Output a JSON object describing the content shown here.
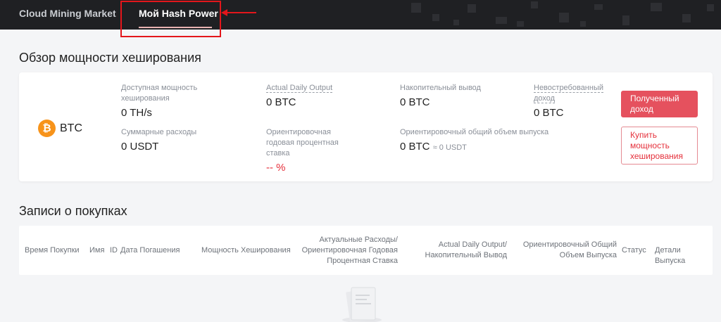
{
  "nav": {
    "market": "Cloud Mining Market",
    "hash_power": "Мой Hash Power"
  },
  "overview": {
    "title": "Обзор мощности хеширования",
    "coin": "BTC",
    "stats": {
      "available_label": "Доступная мощность хеширования",
      "available_value": "0 TH/s",
      "total_expense_label": "Суммарные расходы",
      "total_expense_value": "0 USDT",
      "daily_output_label": "Actual Daily Output",
      "daily_output_value": "0 BTC",
      "annual_rate_label": "Ориентировочная годовая процентная ставка",
      "annual_rate_value": "-- %",
      "accumulated_label": "Накопительный вывод",
      "accumulated_value": "0 BTC",
      "total_output_label": "Ориентировочный общий объем выпуска",
      "total_output_value": "0 BTC",
      "total_output_approx": "≈ 0 USDT",
      "unclaimed_label": "Невостребованный доход",
      "unclaimed_value": "0 BTC"
    },
    "buttons": {
      "received": "Полученный доход",
      "buy": "Купить мощность хеширования"
    }
  },
  "records": {
    "title": "Записи о покупках",
    "columns": {
      "purchase_time": "Время Покупки",
      "name": "Имя",
      "id": "ID",
      "expiry_date": "Дата Погашения",
      "hash_power": "Мощность Хеширования",
      "cost_rate": "Актуальные Расходы/Ориентировочная Годовая Процентная Ставка",
      "daily_output": "Actual Daily Output/Накопительный Вывод",
      "total_output": "Ориентировочный Общий Объем Выпуска",
      "status": "Статус",
      "details": "Детали Выпуска"
    }
  },
  "colors": {
    "topbar": "#1f2023",
    "accent_red": "#e5515e",
    "annotation_red": "#e3161b",
    "btc_orange": "#f7931a"
  },
  "icons": [
    "btc-coin-icon",
    "annotation-arrow-icon",
    "empty-documents-icon"
  ]
}
